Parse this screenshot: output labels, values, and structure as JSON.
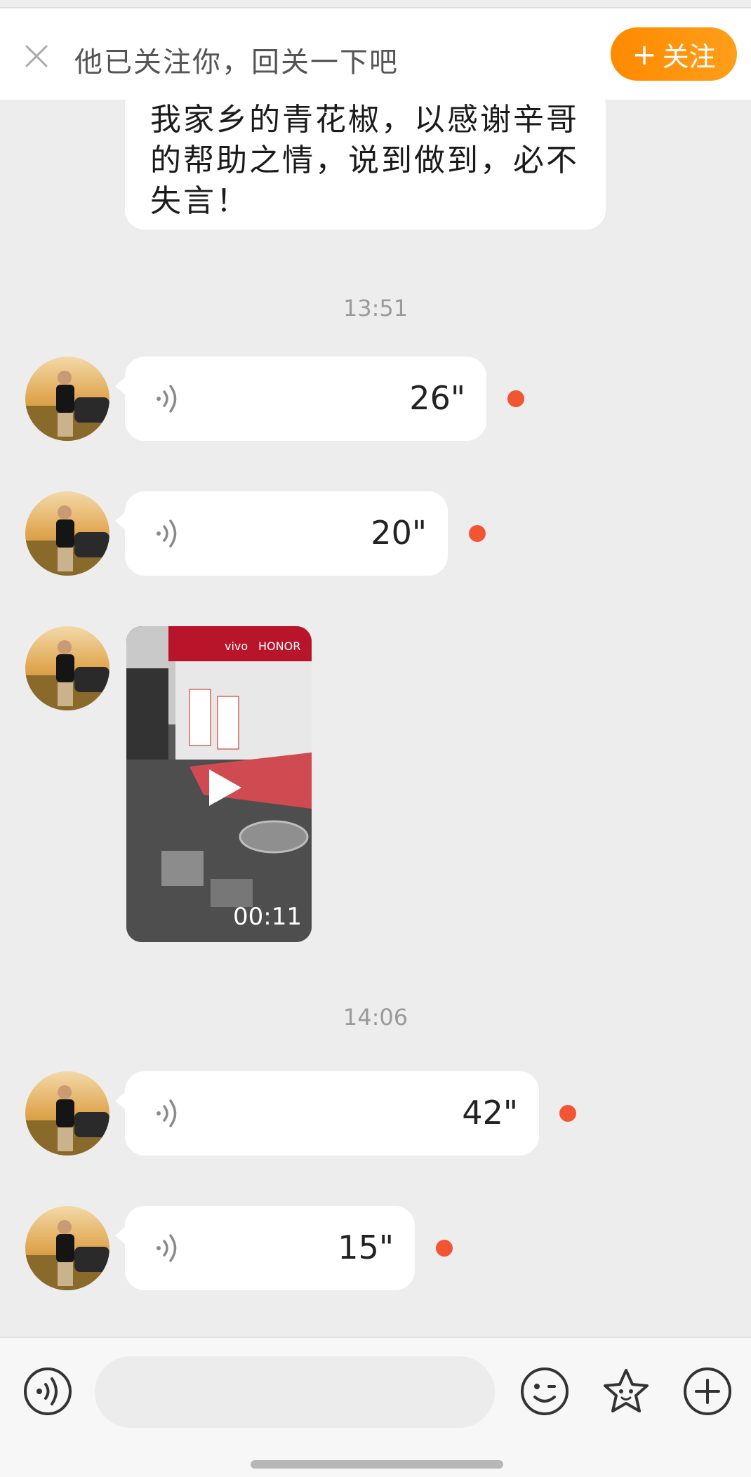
{
  "follow_bar": {
    "text": "他已关注你，回关一下吧",
    "button_label": "关注",
    "button_plus": "+"
  },
  "messages": {
    "partial_text": "我家乡的青花椒，以感谢辛哥的帮助之情，说到做到，必不失言！",
    "time_1": "13:51",
    "voice_1": "26\"",
    "voice_2": "20\"",
    "video_duration": "00:11",
    "video_signage": [
      "vivo",
      "HONOR"
    ],
    "time_2": "14:06",
    "voice_3": "42\"",
    "voice_4": "15\""
  },
  "input": {
    "placeholder": ""
  },
  "colors": {
    "accent_orange": "#ff8a00",
    "unread_dot": "#f25533",
    "chat_bg": "#ededed"
  },
  "icons": [
    "close-icon",
    "voice-wave-icon",
    "play-icon",
    "voice-input-icon",
    "emoji-icon",
    "sticker-icon",
    "plus-icon"
  ]
}
